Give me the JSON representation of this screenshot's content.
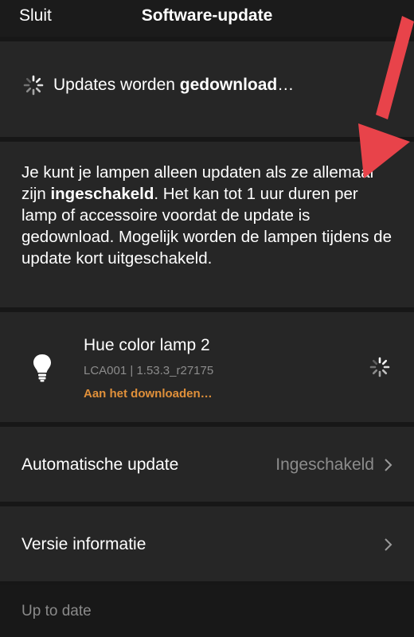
{
  "header": {
    "close_label": "Sluit",
    "title": "Software-update"
  },
  "status": {
    "text_prefix": "Updates worden ",
    "text_bold": "gedownload",
    "text_suffix": "…",
    "icon": "spinner-icon"
  },
  "info": {
    "part1": "Je kunt je lampen alleen updaten als ze allemaal zijn ",
    "bold": "ingeschakeld",
    "part2": ". Het kan tot 1 uur duren per lamp of accessoire voordat de update is gedownload. Mogelijk worden de lampen tijdens de update kort uitgeschakeld."
  },
  "lamp": {
    "name": "Hue color lamp 2",
    "meta": "LCA001 | 1.53.3_r27175",
    "status": "Aan het downloaden…",
    "icon": "bulb-icon",
    "status_color": "#e0903a"
  },
  "auto_update": {
    "label": "Automatische update",
    "value": "Ingeschakeld"
  },
  "version": {
    "label": "Versie informatie"
  },
  "footer": {
    "text": "Up to date"
  },
  "colors": {
    "background": "#171717",
    "panel": "#262626",
    "accent": "#e0903a",
    "annotation_arrow": "#e8434a"
  }
}
